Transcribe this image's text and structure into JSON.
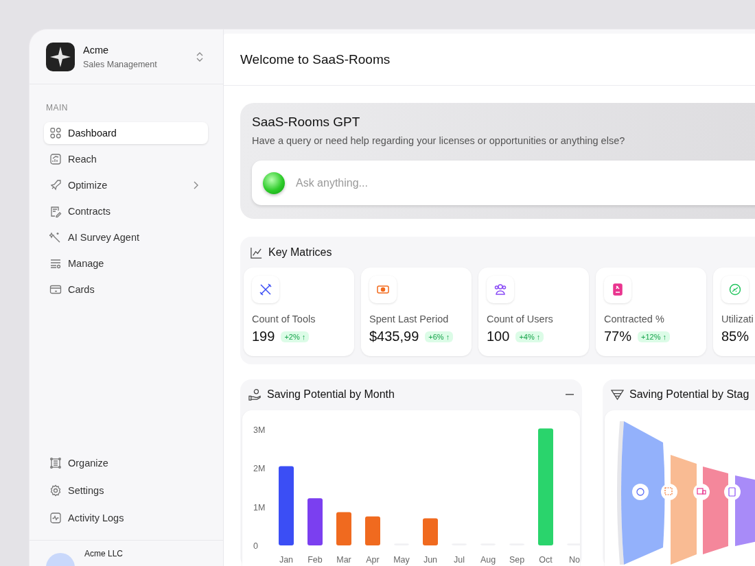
{
  "workspace": {
    "name": "Acme",
    "subtitle": "Sales Management"
  },
  "sidebar": {
    "section_label": "MAIN",
    "items": [
      {
        "label": "Dashboard",
        "selected": true,
        "kind": "link"
      },
      {
        "label": "Reach",
        "selected": false,
        "kind": "link"
      },
      {
        "label": "Optimize",
        "selected": false,
        "kind": "submenu"
      },
      {
        "label": "Contracts",
        "selected": false,
        "kind": "link"
      },
      {
        "label": "AI Survey Agent",
        "selected": false,
        "kind": "link"
      },
      {
        "label": "Manage",
        "selected": false,
        "kind": "link"
      },
      {
        "label": "Cards",
        "selected": false,
        "kind": "link"
      }
    ],
    "bottom_items": [
      {
        "label": "Organize",
        "selected": false
      },
      {
        "label": "Settings",
        "selected": false
      },
      {
        "label": "Activity Logs",
        "selected": false
      }
    ],
    "account": {
      "name": "Acme LLC"
    }
  },
  "header": {
    "title": "Welcome to SaaS-Rooms"
  },
  "assistant": {
    "title": "SaaS-Rooms GPT",
    "subtitle": "Have a query or need help regarding your licenses or opportunities or anything else?",
    "input": {
      "placeholder": "Ask anything..."
    }
  },
  "key_metrics": {
    "title": "Key Matrices",
    "cards": [
      {
        "label": "Count of Tools",
        "value": "199",
        "change": "+2% ↑",
        "color": "#3b4ef5"
      },
      {
        "label": "Spent Last Period",
        "value": "$435,99",
        "change": "+6% ↑",
        "color": "#f26b1d"
      },
      {
        "label": "Count of Users",
        "value": "100",
        "change": "+4% ↑",
        "color": "#8b4cf6"
      },
      {
        "label": "Contracted %",
        "value": "77%",
        "change": "+12% ↑",
        "color": "#e9358f"
      },
      {
        "label": "Utilizati",
        "value": "85%",
        "color": "#22c55e"
      }
    ]
  },
  "saving_by_month": {
    "title": "Saving Potential by Month",
    "chart_data": {
      "type": "bar",
      "categories": [
        "Jan",
        "Feb",
        "Mar",
        "Apr",
        "May",
        "Jun",
        "Jul",
        "Aug",
        "Sep",
        "Oct",
        "No"
      ],
      "series": [
        {
          "color": "#3b4ef5",
          "values": [
            2.05,
            null,
            null,
            null,
            null,
            null,
            null,
            null,
            null,
            null,
            null
          ]
        },
        {
          "color": "#7b3ff0",
          "values": [
            null,
            1.22,
            null,
            null,
            null,
            null,
            null,
            null,
            null,
            null,
            null
          ]
        },
        {
          "color": "#f06a1f",
          "values": [
            null,
            null,
            0.86,
            0.75,
            null,
            0.7,
            null,
            null,
            null,
            null,
            null
          ]
        },
        {
          "color": "#f1f1f4",
          "values": [
            null,
            null,
            null,
            null,
            0.05,
            null,
            0.05,
            0.05,
            0.05,
            null,
            0.05
          ]
        },
        {
          "color": "#2ad46c",
          "values": [
            null,
            null,
            null,
            null,
            null,
            null,
            null,
            null,
            null,
            3.03,
            null
          ]
        }
      ],
      "ylim": [
        0,
        3.1
      ],
      "yticks": [
        {
          "value": 0,
          "label": "0"
        },
        {
          "value": 1,
          "label": "1M"
        },
        {
          "value": 2,
          "label": "2M"
        },
        {
          "value": 3,
          "label": "3M"
        }
      ]
    }
  },
  "saving_by_stage": {
    "title": "Saving Potential by Stag"
  }
}
